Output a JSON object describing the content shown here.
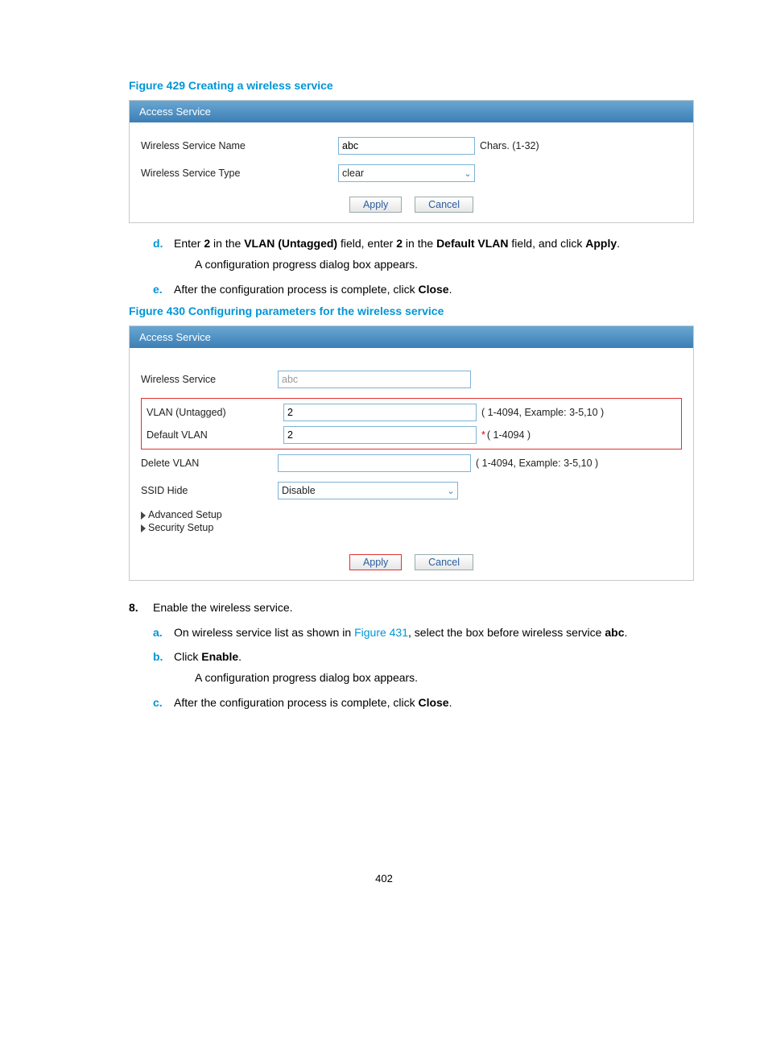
{
  "fig429": {
    "caption": "Figure 429 Creating a wireless service",
    "panel_title": "Access Service",
    "name_label": "Wireless Service Name",
    "name_value": "abc",
    "name_hint": "Chars. (1-32)",
    "type_label": "Wireless Service Type",
    "type_value": "clear",
    "apply": "Apply",
    "cancel": "Cancel"
  },
  "steps1": {
    "d": {
      "marker": "d.",
      "t1": "Enter ",
      "b1": "2",
      "t2": " in the ",
      "b2": "VLAN (Untagged)",
      "t3": " field, enter ",
      "b3": "2",
      "t4": " in the ",
      "b4": "Default VLAN",
      "t5": " field, and click ",
      "b5": "Apply",
      "t6": ".",
      "line2": "A configuration progress dialog box appears."
    },
    "e": {
      "marker": "e.",
      "t1": "After the configuration process is complete, click ",
      "b1": "Close",
      "t2": "."
    }
  },
  "fig430": {
    "caption": "Figure 430 Configuring parameters for the wireless service",
    "panel_title": "Access Service",
    "ws_label": "Wireless Service",
    "ws_value": "abc",
    "vlan_u_label": "VLAN (Untagged)",
    "vlan_u_value": "2",
    "vlan_u_hint": "( 1-4094, Example: 3-5,10 )",
    "def_vlan_label": "Default VLAN",
    "def_vlan_value": "2",
    "def_vlan_hint": "( 1-4094 )",
    "del_vlan_label": "Delete VLAN",
    "del_vlan_value": "",
    "del_vlan_hint": "( 1-4094, Example: 3-5,10 )",
    "ssid_hide_label": "SSID Hide",
    "ssid_hide_value": "Disable",
    "adv": "Advanced Setup",
    "sec": "Security Setup",
    "apply": "Apply",
    "cancel": "Cancel"
  },
  "num8": {
    "marker": "8.",
    "text": "Enable the wireless service."
  },
  "steps2": {
    "a": {
      "marker": "a.",
      "t1": "On wireless service list as shown in ",
      "link": "Figure 431",
      "t2": ", select the box before wireless service ",
      "b1": "abc",
      "t3": "."
    },
    "b": {
      "marker": "b.",
      "t1": "Click ",
      "b1": "Enable",
      "t2": ".",
      "line2": "A configuration progress dialog box appears."
    },
    "c": {
      "marker": "c.",
      "t1": "After the configuration process is complete, click ",
      "b1": "Close",
      "t2": "."
    }
  },
  "page": "402"
}
